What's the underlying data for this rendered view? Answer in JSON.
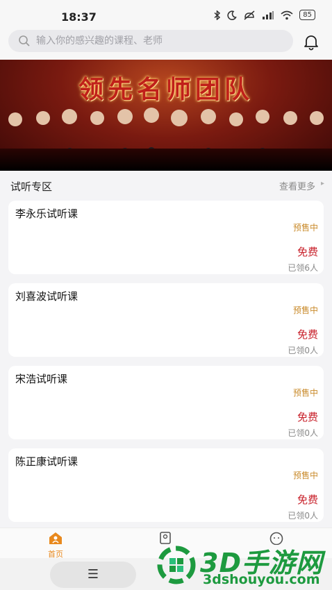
{
  "status_bar": {
    "time": "18:37",
    "battery": "85",
    "icons": [
      "bluetooth-icon",
      "moon-icon",
      "mute-icon",
      "signal-icon",
      "wifi-icon",
      "battery-icon"
    ]
  },
  "search": {
    "placeholder": "输入你的感兴趣的课程、老师",
    "value": ""
  },
  "banner": {
    "title": "领先名师团队"
  },
  "trial_section": {
    "title": "试听专区",
    "more_label": "查看更多",
    "more_arrow": "▸"
  },
  "courses": [
    {
      "title": "李永乐试听课",
      "status": "预售中",
      "price": "免费",
      "count": "已领6人"
    },
    {
      "title": "刘喜波试听课",
      "status": "预售中",
      "price": "免费",
      "count": "已领0人"
    },
    {
      "title": "宋浩试听课",
      "status": "预售中",
      "price": "免费",
      "count": "已领0人"
    },
    {
      "title": "陈正康试听课",
      "status": "预售中",
      "price": "免费",
      "count": "已领0人"
    }
  ],
  "tabbar": {
    "home_label": "首页"
  },
  "system_nav": {
    "menu_glyph": "☰"
  },
  "watermark": {
    "title": "3D手游网",
    "url": "3dshouyou.com"
  },
  "colors": {
    "accent_orange": "#c98a2a",
    "price_red": "#c8202a",
    "tab_active": "#e8891e",
    "watermark_green": "#1d9a3f"
  }
}
